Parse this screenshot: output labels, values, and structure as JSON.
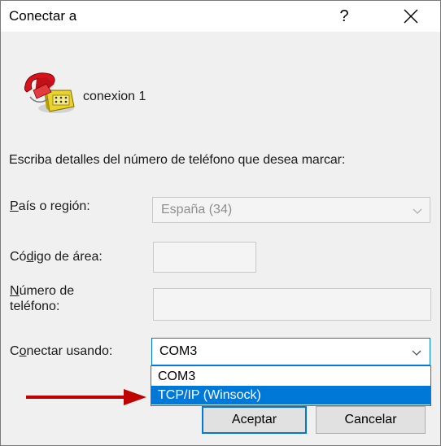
{
  "dialog": {
    "title": "Conectar a",
    "help_symbol": "?",
    "connection_name": "conexion 1",
    "instructions": "Escriba detalles del número de teléfono que desea marcar:"
  },
  "country": {
    "label_pre": "",
    "label_ul": "P",
    "label_post": "aís o región:",
    "value": "España (34)"
  },
  "area_code": {
    "label_pre": "Có",
    "label_ul": "d",
    "label_post": "igo de área:",
    "value": ""
  },
  "phone": {
    "label_line1_ul": "N",
    "label_line1_post": "úmero de",
    "label_line2": "teléfono:",
    "value": ""
  },
  "connect_using": {
    "label_pre": "C",
    "label_ul": "o",
    "label_post": "nectar usando:",
    "value": "COM3",
    "options": [
      "COM3",
      "TCP/IP (Winsock)"
    ],
    "highlighted": "TCP/IP (Winsock)"
  },
  "buttons": {
    "ok": "Aceptar",
    "cancel": "Cancelar"
  },
  "colors": {
    "accent": "#0078d7",
    "arrow": "#c00000"
  },
  "icons": {
    "app": "phone-icon",
    "close": "close-icon",
    "dropdown": "chevron-down-icon"
  }
}
